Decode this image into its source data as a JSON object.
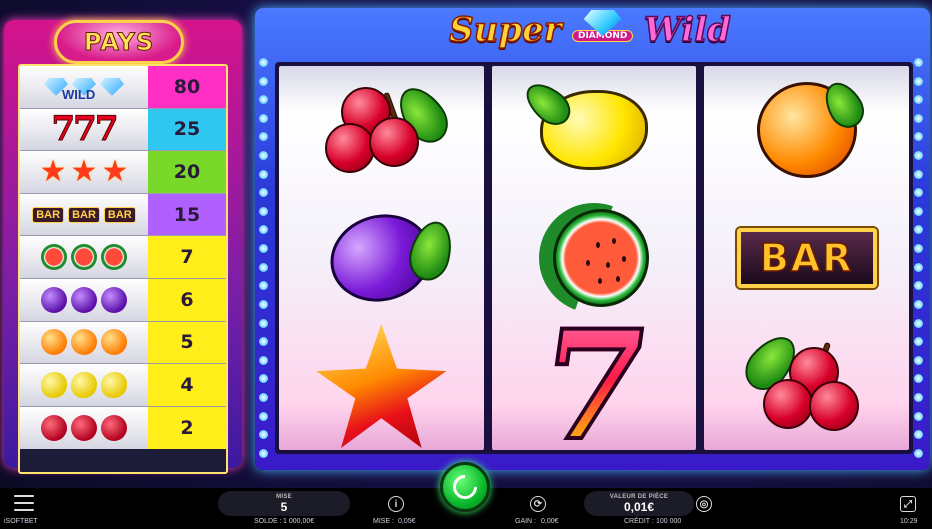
{
  "paytable": {
    "title": "PAYS",
    "rows": [
      {
        "symbol": "wild",
        "label": "WILD",
        "payout": "80",
        "color": "#ff2fc6"
      },
      {
        "symbol": "seven",
        "label": "777",
        "payout": "25",
        "color": "#2fc6f0"
      },
      {
        "symbol": "star",
        "payout": "20",
        "color": "#7ad82a"
      },
      {
        "symbol": "bar",
        "label": "BAR",
        "payout": "15",
        "color": "#b060ff"
      },
      {
        "symbol": "watermelon",
        "payout": "7",
        "color": "#ffee1a"
      },
      {
        "symbol": "plum",
        "payout": "6",
        "color": "#ffee1a"
      },
      {
        "symbol": "orange",
        "payout": "5",
        "color": "#ffee1a"
      },
      {
        "symbol": "lemon",
        "payout": "4",
        "color": "#ffee1a"
      },
      {
        "symbol": "cherry",
        "payout": "2",
        "color": "#ffee1a"
      }
    ]
  },
  "game": {
    "title_left": "Super",
    "title_badge": "DIAMOND",
    "title_right": "Wild",
    "reels": [
      [
        "cherry",
        "plum",
        "star"
      ],
      [
        "lemon",
        "watermelon",
        "seven"
      ],
      [
        "orange",
        "bar",
        "cherry"
      ]
    ],
    "bar_label": "BAR",
    "seven_label": "7"
  },
  "hud": {
    "bet_label": "MISE",
    "bet_value": "5",
    "coin_label": "VALEUR DE PIÈCE",
    "coin_value": "0,01€",
    "info_icon": "info-icon",
    "autoplay_icon": "autoplay-icon",
    "coins_icon": "coins-icon",
    "fullscreen_icon": "expand-icon",
    "menu_icon": "menu-icon",
    "spin_icon": "spin-arrow-icon"
  },
  "status": {
    "brand": "iSOFTBET",
    "balance_label": "SOLDE :",
    "balance_value": "1 000,00€",
    "bet_label": "MISE :",
    "bet_value": "0,05€",
    "win_label": "GAIN :",
    "win_value": "0,00€",
    "credit_label": "CRÉDIT :",
    "credit_value": "100 000",
    "time": "10:29"
  }
}
